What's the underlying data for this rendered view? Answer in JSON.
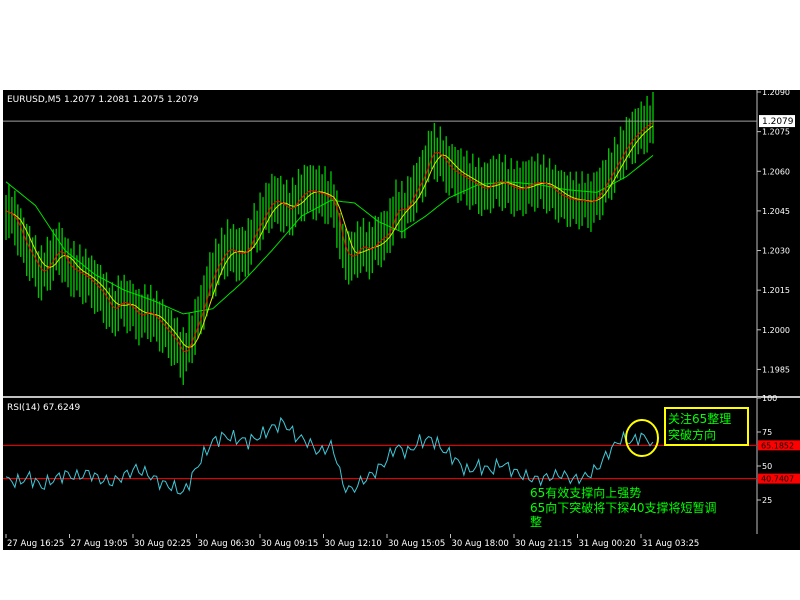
{
  "chart_data": [
    {
      "type": "bar",
      "subtype": "ohlc-price-chart",
      "symbol_info": "EURUSD,M5  1.2077 1.2081 1.2075 1.2079",
      "current_price_label": "1.2079",
      "current_price": 1.2079,
      "y_tick_labels": [
        "1.2090",
        "1.2075",
        "1.2060",
        "1.2045",
        "1.2030",
        "1.2015",
        "1.2000",
        "1.1985"
      ],
      "ylim": [
        1.1981,
        1.209
      ],
      "grid": false,
      "colors": {
        "background": "#000000",
        "bars": "#00c000",
        "ma_fast": "#e8e000",
        "ma_slow": "#00e000",
        "ma_red": "#ff0000",
        "price_line": "#a0a0a0"
      },
      "price_path": [
        [
          0,
          1.2045
        ],
        [
          3,
          1.2042
        ],
        [
          6,
          1.2033
        ],
        [
          9,
          1.2027
        ],
        [
          12,
          1.2021
        ],
        [
          15,
          1.2026
        ],
        [
          18,
          1.2031
        ],
        [
          21,
          1.2024
        ],
        [
          24,
          1.2022
        ],
        [
          27,
          1.202
        ],
        [
          30,
          1.2017
        ],
        [
          33,
          1.2013
        ],
        [
          36,
          1.2007
        ],
        [
          39,
          1.2011
        ],
        [
          42,
          1.2009
        ],
        [
          45,
          1.2005
        ],
        [
          48,
          1.2007
        ],
        [
          51,
          1.2004
        ],
        [
          54,
          1.2
        ],
        [
          57,
          1.1996
        ],
        [
          60,
          1.199
        ],
        [
          63,
          1.1998
        ],
        [
          66,
          1.2007
        ],
        [
          69,
          1.2019
        ],
        [
          72,
          1.2026
        ],
        [
          75,
          1.2031
        ],
        [
          78,
          1.2029
        ],
        [
          81,
          1.2029
        ],
        [
          84,
          1.2037
        ],
        [
          87,
          1.2043
        ],
        [
          90,
          1.2049
        ],
        [
          93,
          1.2048
        ],
        [
          96,
          1.2045
        ],
        [
          99,
          1.205
        ],
        [
          102,
          1.2053
        ],
        [
          105,
          1.2052
        ],
        [
          108,
          1.2051
        ],
        [
          111,
          1.2048
        ],
        [
          114,
          1.203
        ],
        [
          117,
          1.2027
        ],
        [
          120,
          1.2032
        ],
        [
          123,
          1.203
        ],
        [
          126,
          1.2034
        ],
        [
          129,
          1.2036
        ],
        [
          132,
          1.2046
        ],
        [
          135,
          1.2045
        ],
        [
          138,
          1.2052
        ],
        [
          141,
          1.2058
        ],
        [
          144,
          1.2068
        ],
        [
          147,
          1.2066
        ],
        [
          150,
          1.2061
        ],
        [
          153,
          1.2059
        ],
        [
          156,
          1.2057
        ],
        [
          159,
          1.2055
        ],
        [
          162,
          1.2053
        ],
        [
          165,
          1.2056
        ],
        [
          168,
          1.2056
        ],
        [
          171,
          1.2054
        ],
        [
          174,
          1.2053
        ],
        [
          177,
          1.2055
        ],
        [
          180,
          1.2056
        ],
        [
          183,
          1.2055
        ],
        [
          186,
          1.2052
        ],
        [
          189,
          1.205
        ],
        [
          192,
          1.2049
        ],
        [
          195,
          1.2049
        ],
        [
          198,
          1.2048
        ],
        [
          201,
          1.2052
        ],
        [
          204,
          1.2058
        ],
        [
          207,
          1.2064
        ],
        [
          210,
          1.207
        ],
        [
          213,
          1.2074
        ],
        [
          216,
          1.2077
        ],
        [
          219,
          1.2079
        ]
      ],
      "ma_slow_path": [
        [
          0,
          1.2056
        ],
        [
          10,
          1.2047
        ],
        [
          20,
          1.203
        ],
        [
          30,
          1.2021
        ],
        [
          40,
          1.2015
        ],
        [
          50,
          1.2011
        ],
        [
          60,
          1.2006
        ],
        [
          70,
          1.2008
        ],
        [
          80,
          1.2018
        ],
        [
          90,
          1.203
        ],
        [
          100,
          1.2043
        ],
        [
          110,
          1.2049
        ],
        [
          118,
          1.2048
        ],
        [
          126,
          1.2041
        ],
        [
          134,
          1.2037
        ],
        [
          142,
          1.2043
        ],
        [
          150,
          1.205
        ],
        [
          160,
          1.2055
        ],
        [
          170,
          1.2056
        ],
        [
          180,
          1.2055
        ],
        [
          190,
          1.2053
        ],
        [
          200,
          1.2052
        ],
        [
          210,
          1.2058
        ],
        [
          219,
          1.2066
        ]
      ]
    },
    {
      "type": "line",
      "subtype": "rsi-indicator",
      "indicator_label": "RSI(14)  67.6249",
      "y_tick_labels": [
        "100",
        "75",
        "50",
        "25"
      ],
      "ylim": [
        0,
        100
      ],
      "levels": [
        {
          "value": 65.1852,
          "label": "65.1852"
        },
        {
          "value": 40.7407,
          "label": "40.7407"
        }
      ],
      "rsi_path": [
        [
          0,
          40
        ],
        [
          4,
          38
        ],
        [
          8,
          42
        ],
        [
          12,
          35
        ],
        [
          16,
          40
        ],
        [
          20,
          44
        ],
        [
          24,
          42
        ],
        [
          28,
          45
        ],
        [
          32,
          40
        ],
        [
          36,
          38
        ],
        [
          40,
          43
        ],
        [
          44,
          48
        ],
        [
          48,
          44
        ],
        [
          52,
          38
        ],
        [
          56,
          35
        ],
        [
          60,
          30
        ],
        [
          62,
          38
        ],
        [
          66,
          55
        ],
        [
          70,
          68
        ],
        [
          74,
          72
        ],
        [
          78,
          70
        ],
        [
          82,
          68
        ],
        [
          86,
          72
        ],
        [
          90,
          78
        ],
        [
          94,
          82
        ],
        [
          98,
          72
        ],
        [
          102,
          68
        ],
        [
          106,
          60
        ],
        [
          110,
          65
        ],
        [
          112,
          55
        ],
        [
          114,
          36
        ],
        [
          117,
          32
        ],
        [
          120,
          38
        ],
        [
          124,
          44
        ],
        [
          128,
          52
        ],
        [
          132,
          64
        ],
        [
          136,
          60
        ],
        [
          140,
          68
        ],
        [
          144,
          70
        ],
        [
          148,
          62
        ],
        [
          152,
          55
        ],
        [
          156,
          46
        ],
        [
          160,
          50
        ],
        [
          164,
          47
        ],
        [
          168,
          52
        ],
        [
          172,
          46
        ],
        [
          176,
          42
        ],
        [
          180,
          40
        ],
        [
          184,
          42
        ],
        [
          188,
          44
        ],
        [
          192,
          40
        ],
        [
          196,
          42
        ],
        [
          200,
          48
        ],
        [
          204,
          60
        ],
        [
          208,
          70
        ],
        [
          212,
          68
        ],
        [
          215,
          72
        ],
        [
          219,
          67.6
        ]
      ],
      "colors": {
        "rsi_line": "#40c8d8",
        "levels": "#ff0000"
      }
    }
  ],
  "x_tick_labels": [
    "27 Aug 16:25",
    "27 Aug 19:05",
    "30 Aug 02:25",
    "30 Aug 06:30",
    "30 Aug 09:15",
    "30 Aug 12:10",
    "30 Aug 15:05",
    "30 Aug 18:00",
    "30 Aug 21:15",
    "31 Aug 00:20",
    "31 Aug 03:25"
  ],
  "annotations": {
    "box_text_line1": "关注65整理",
    "box_text_line2": "突破方向",
    "note_line1": "65有效支撑向上强势",
    "note_line2": "65向下突破将下探40支撑将短暂调",
    "note_line3": "整"
  }
}
